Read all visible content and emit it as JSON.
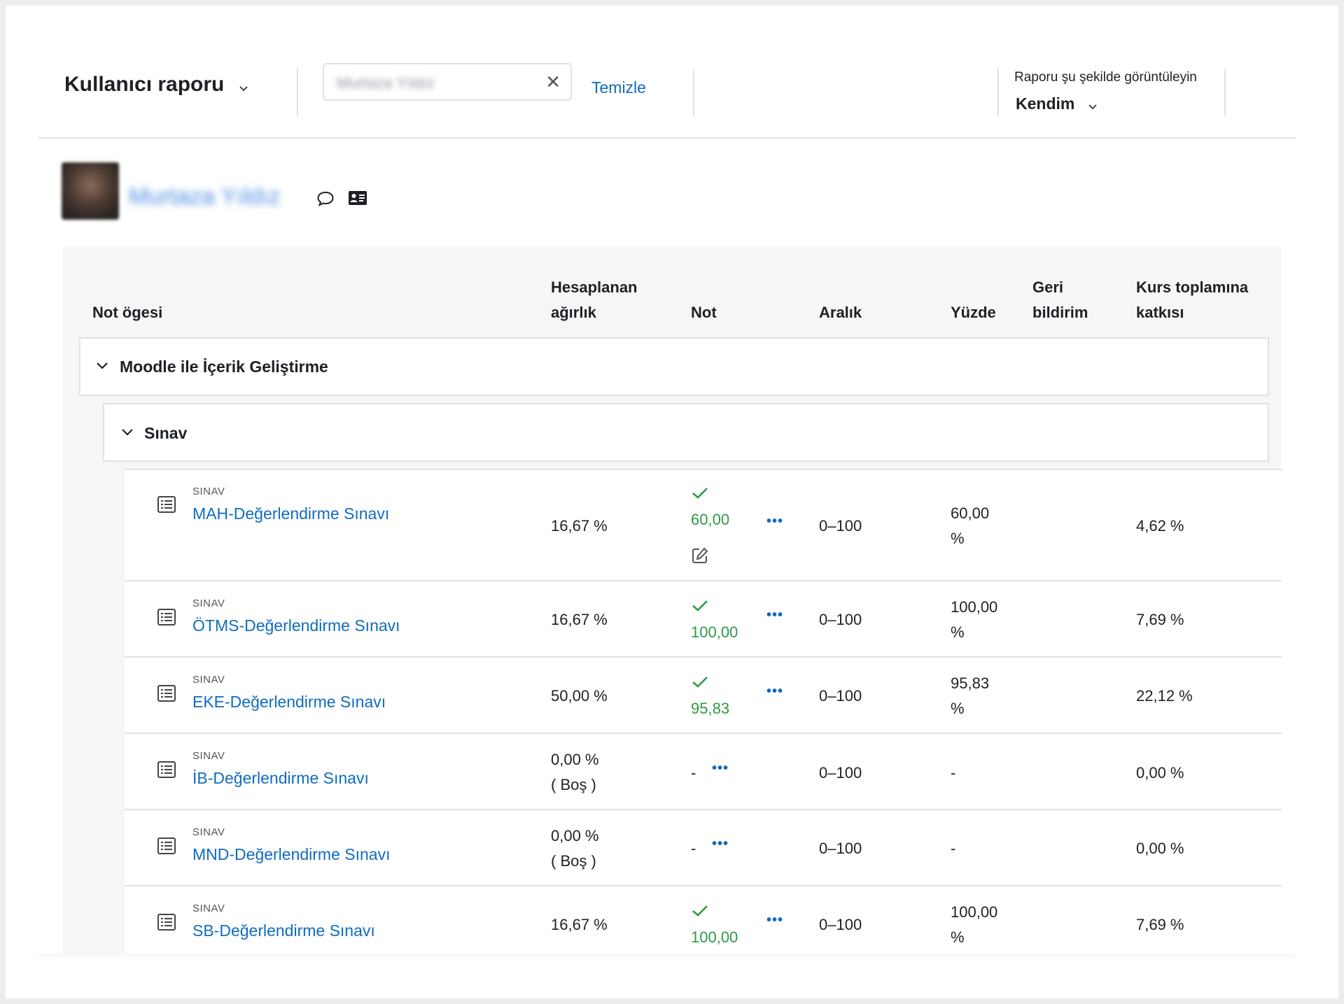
{
  "header": {
    "report_title": "Kullanıcı raporu",
    "search_value": "Murtaza Yıldız",
    "clear_link": "Temizle",
    "view_as_label": "Raporu şu şekilde görüntüleyin",
    "view_as_value": "Kendim"
  },
  "user": {
    "name": "Murtaza Yıldız"
  },
  "table": {
    "headers": {
      "item": "Not ögesi",
      "weight_line1": "Hesaplanan",
      "weight_line2": "ağırlık",
      "grade": "Not",
      "range": "Aralık",
      "percentage": "Yüzde",
      "feedback_line1": "Geri",
      "feedback_line2": "bildirim",
      "contribution_line1": "Kurs toplamına",
      "contribution_line2": "katkısı"
    },
    "category": "Moodle ile İçerik Geliştirme",
    "subcategory": "Sınav",
    "rows": [
      {
        "type": "SINAV",
        "name": "MAH-Değerlendirme Sınavı",
        "weight": "16,67 %",
        "weight_sub": "",
        "grade": "60,00",
        "range": "0–100",
        "pct1": "60,00",
        "pct2": "%",
        "contribution": "4,62 %"
      },
      {
        "type": "SINAV",
        "name": "ÖTMS-Değerlendirme Sınavı",
        "weight": "16,67 %",
        "weight_sub": "",
        "grade": "100,00",
        "range": "0–100",
        "pct1": "100,00",
        "pct2": "%",
        "contribution": "7,69 %"
      },
      {
        "type": "SINAV",
        "name": "EKE-Değerlendirme Sınavı",
        "weight": "50,00 %",
        "weight_sub": "",
        "grade": "95,83",
        "range": "0–100",
        "pct1": "95,83",
        "pct2": "%",
        "contribution": "22,12 %"
      },
      {
        "type": "SINAV",
        "name": "İB-Değerlendirme Sınavı",
        "weight": "0,00 %",
        "weight_sub": "( Boş )",
        "grade": "-",
        "range": "0–100",
        "pct1": "-",
        "pct2": "",
        "contribution": "0,00 %"
      },
      {
        "type": "SINAV",
        "name": "MND-Değerlendirme Sınavı",
        "weight": "0,00 %",
        "weight_sub": "( Boş )",
        "grade": "-",
        "range": "0–100",
        "pct1": "-",
        "pct2": "",
        "contribution": "0,00 %"
      },
      {
        "type": "SINAV",
        "name": "SB-Değerlendirme Sınavı",
        "weight": "16,67 %",
        "weight_sub": "",
        "grade": "100,00",
        "range": "0–100",
        "pct1": "100,00",
        "pct2": "%",
        "contribution": "7,69 %"
      }
    ]
  },
  "icons": {
    "chevron": "chevron-down-icon",
    "clear": "close-icon",
    "message": "speech-bubble-icon",
    "profile": "id-card-icon",
    "quiz": "quiz-icon",
    "graded": "checkmark-icon",
    "edit": "edit-icon",
    "actions": "ellipsis-icon"
  },
  "colors": {
    "link": "#0f6cbf",
    "graded": "#2e9a43",
    "table_bg": "#f5f6f7",
    "border": "#dee2e6"
  }
}
